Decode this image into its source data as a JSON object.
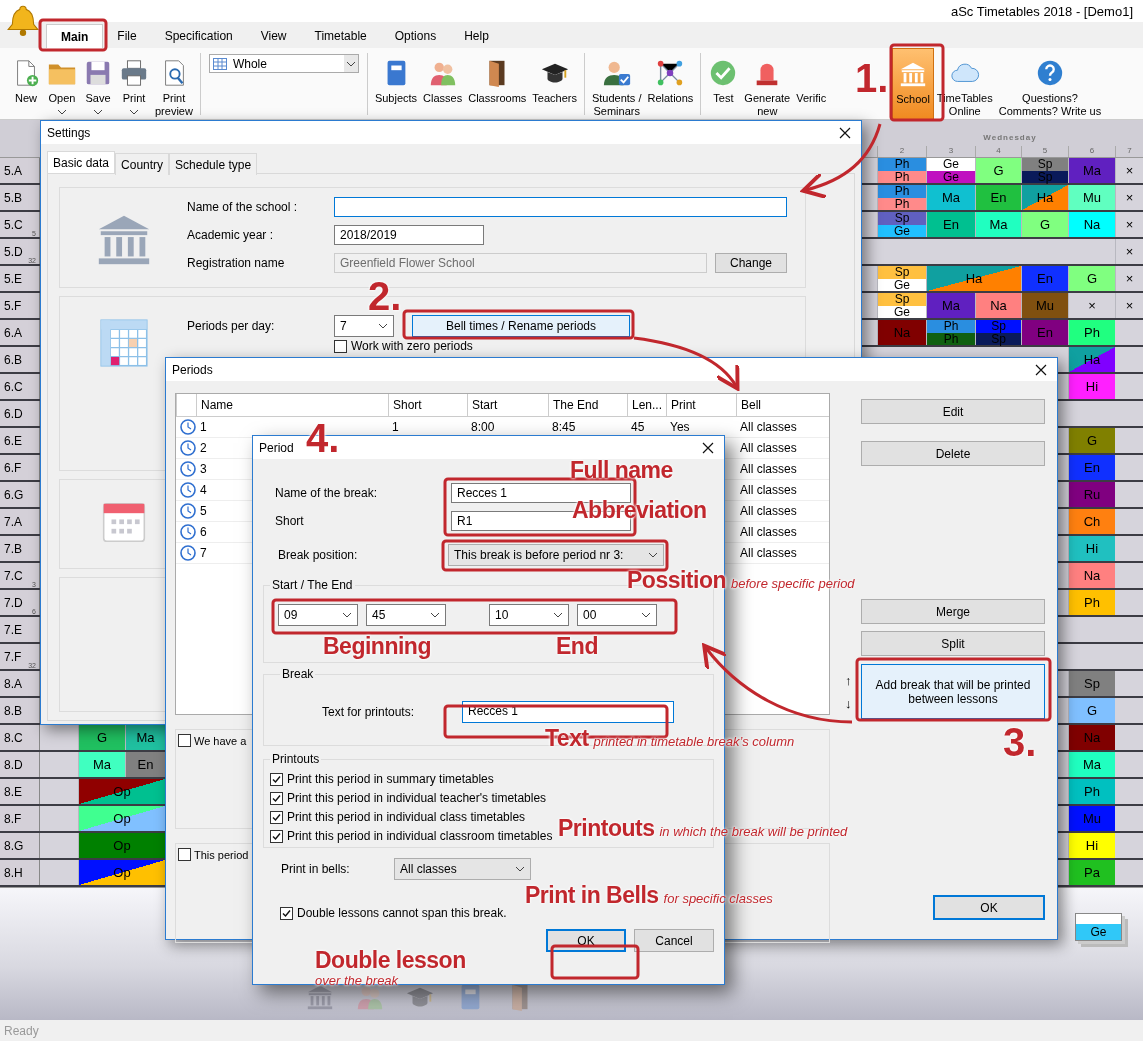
{
  "window": {
    "title": "aSc Timetables 2018  - [Demo1]"
  },
  "menu": [
    {
      "label": "Main",
      "selected": true
    },
    {
      "label": "File",
      "selected": false
    },
    {
      "label": "Specification",
      "selected": false
    },
    {
      "label": "View",
      "selected": false
    },
    {
      "label": "Timetable",
      "selected": false
    },
    {
      "label": "Options",
      "selected": false
    },
    {
      "label": "Help",
      "selected": false
    }
  ],
  "toolbar": {
    "file_buttons": [
      {
        "label": "New",
        "dropdown": false
      },
      {
        "label": "Open",
        "dropdown": true
      },
      {
        "label": "Save",
        "dropdown": true
      },
      {
        "label": "Print",
        "dropdown": true
      },
      {
        "label": "Print\npreview",
        "dropdown": false
      }
    ],
    "view_select": {
      "value": "Whole"
    },
    "groups": [
      [
        {
          "label": "Subjects",
          "selected": false
        },
        {
          "label": "Classes",
          "selected": false
        },
        {
          "label": "Classrooms",
          "selected": false
        },
        {
          "label": "Teachers",
          "selected": false
        }
      ],
      [
        {
          "label": "Students /\nSeminars",
          "selected": false
        },
        {
          "label": "Relations",
          "selected": false
        }
      ],
      [
        {
          "label": "Test",
          "selected": false
        },
        {
          "label": "Generate\nnew",
          "selected": false
        },
        {
          "label": "Verific",
          "selected": false
        },
        {
          "label": "School",
          "selected": true
        },
        {
          "label": "TimeTables\nOnline",
          "selected": false
        },
        {
          "label": "Questions?\nComments? Write us",
          "selected": false
        }
      ]
    ]
  },
  "timetable": {
    "day": "Wednesday",
    "columns": [
      "2",
      "3",
      "4",
      "5",
      "6",
      "7"
    ],
    "rows": [
      {
        "label": "5.A",
        "cells": [
          {
            "kind": "split",
            "top": {
              "text": "Ph",
              "color": "#2a8ee0"
            },
            "bottom": {
              "text": "Ph",
              "color": "#ff8a8a"
            }
          },
          {
            "kind": "split",
            "top": {
              "text": "Ge",
              "color": "#ffffff"
            },
            "bottom": {
              "text": "Ge",
              "color": "#c010c0"
            }
          },
          {
            "kind": "single",
            "text": "G",
            "color": "#80ff80"
          },
          {
            "kind": "split",
            "top": {
              "text": "Sp",
              "color": "#808080"
            },
            "bottom": {
              "text": "Sp",
              "color": "#0a1a5a"
            }
          },
          {
            "kind": "single",
            "text": "Ma",
            "color": "#6020c0"
          },
          {
            "kind": "single",
            "text": "×"
          }
        ]
      },
      {
        "label": "5.B",
        "cells": [
          {
            "kind": "split",
            "top": {
              "text": "Ph",
              "color": "#2a8ee0"
            },
            "bottom": {
              "text": "Ph",
              "color": "#ff8a8a"
            }
          },
          {
            "kind": "single",
            "text": "Ma",
            "color": "#10c0d0"
          },
          {
            "kind": "single",
            "text": "En",
            "color": "#20c040"
          },
          {
            "kind": "diagonal",
            "text": "Ha",
            "color": "#10a0a0",
            "corner": {
              "color": "#ff8000"
            }
          },
          {
            "kind": "single",
            "text": "Mu",
            "color": "#60ffc0"
          },
          {
            "kind": "single",
            "text": "×"
          }
        ]
      },
      {
        "label": "5.C",
        "note": "5",
        "cells": [
          {
            "kind": "split",
            "top": {
              "text": "Sp",
              "color": "#6060c0"
            },
            "bottom": {
              "text": "Ge",
              "color": "#20c0ff"
            }
          },
          {
            "kind": "single",
            "text": "En",
            "color": "#00c090"
          },
          {
            "kind": "single",
            "text": "Ma",
            "color": "#20ffc0"
          },
          {
            "kind": "single",
            "text": "G",
            "color": "#80ff80"
          },
          {
            "kind": "single",
            "text": "Na",
            "color": "#00ffff"
          },
          {
            "kind": "single",
            "text": "×"
          }
        ]
      },
      {
        "label": "5.D",
        "note": "32",
        "cells": [
          "",
          "",
          "",
          "",
          "",
          {
            "kind": "single",
            "text": "×"
          }
        ]
      },
      {
        "label": "5.E",
        "cells": [
          {
            "kind": "split",
            "top": {
              "text": "Sp",
              "color": "#ffc040"
            },
            "bottom": {
              "text": "Ge",
              "color": "#ffffff"
            }
          },
          {
            "kind": "wide-diagonal",
            "text": "Ha",
            "color": "#10a0a0",
            "corner": {
              "color": "#ff8000"
            }
          },
          "",
          {
            "kind": "single",
            "text": "En",
            "color": "#1030ff"
          },
          {
            "kind": "single",
            "text": "G",
            "color": "#80ff80"
          },
          {
            "kind": "single",
            "text": "×"
          }
        ]
      },
      {
        "label": "5.F",
        "cells": [
          {
            "kind": "split",
            "top": {
              "text": "Sp",
              "color": "#ffc040"
            },
            "bottom": {
              "text": "Ge",
              "color": "#ffffff"
            }
          },
          {
            "kind": "single",
            "text": "Ma",
            "color": "#6020c0"
          },
          {
            "kind": "single",
            "text": "Na",
            "color": "#ff8080"
          },
          {
            "kind": "single",
            "text": "Mu",
            "color": "#805010"
          },
          {
            "kind": "single",
            "text": "×"
          },
          {
            "kind": "single",
            "text": "×"
          }
        ]
      },
      {
        "label": "6.A",
        "cells": [
          {
            "kind": "single",
            "text": "Na",
            "color": "#800000"
          },
          {
            "kind": "split",
            "top": {
              "text": "Ph",
              "color": "#2a8ee0"
            },
            "bottom": {
              "text": "Ph",
              "color": "#106010"
            }
          },
          {
            "kind": "split",
            "top": {
              "text": "Sp",
              "color": "#0010ff"
            },
            "bottom": {
              "text": "Sp",
              "color": "#0a1a5a"
            }
          },
          {
            "kind": "single",
            "text": "En",
            "color": "#800080"
          },
          {
            "kind": "single",
            "text": "Ph",
            "color": "#20ff80"
          }
        ]
      },
      {
        "label": "6.B",
        "cells": [
          "",
          "",
          "",
          "",
          {
            "kind": "diagonal",
            "text": "Ha",
            "color": "#10a0a0",
            "corner": {
              "color": "#8000ff"
            }
          }
        ]
      },
      {
        "label": "6.C",
        "cells": [
          "",
          "",
          "",
          "",
          {
            "kind": "single",
            "text": "Hi",
            "color": "#ff20ff"
          }
        ]
      },
      {
        "label": "6.D",
        "cells": []
      },
      {
        "label": "6.E",
        "cells": [
          "",
          "",
          "",
          "",
          {
            "kind": "single",
            "text": "G",
            "color": "#808000"
          }
        ]
      },
      {
        "label": "6.F",
        "cells": [
          "",
          "",
          "",
          "",
          {
            "kind": "single",
            "text": "En",
            "color": "#1030ff"
          }
        ]
      },
      {
        "label": "6.G",
        "cells": [
          "",
          "",
          "",
          "",
          {
            "kind": "single",
            "text": "Ru",
            "color": "#800080"
          }
        ]
      },
      {
        "label": "7.A",
        "cells": [
          "",
          "",
          "",
          "",
          {
            "kind": "single",
            "text": "Ch",
            "color": "#ff8010"
          }
        ]
      },
      {
        "label": "7.B",
        "cells": [
          "",
          "",
          "",
          "",
          {
            "kind": "single",
            "text": "Hi",
            "color": "#20c0c0"
          }
        ]
      },
      {
        "label": "7.C",
        "note": "3",
        "cells": [
          "",
          "",
          "",
          "",
          {
            "kind": "single",
            "text": "Na",
            "color": "#ff8080"
          }
        ]
      },
      {
        "label": "7.D",
        "note": "6",
        "cells": [
          "",
          "",
          "",
          "",
          {
            "kind": "single",
            "text": "Ph",
            "color": "#ffc000"
          }
        ]
      },
      {
        "label": "7.E",
        "cells": []
      },
      {
        "label": "7.F",
        "note": "32",
        "cells": []
      },
      {
        "label": "8.A",
        "cells": [
          "",
          "",
          "",
          "",
          {
            "kind": "single",
            "text": "Sp",
            "color": "#808080"
          }
        ]
      },
      {
        "label": "8.B",
        "cells": [
          "",
          "",
          "",
          "",
          {
            "kind": "single",
            "text": "G",
            "color": "#80c0ff"
          }
        ]
      },
      {
        "label": "8.C",
        "left": [
          {
            "kind": "single",
            "text": "G",
            "color": "#20c060"
          },
          {
            "kind": "single",
            "text": "Ma",
            "color": "#20c0a0"
          }
        ],
        "cells": [
          "",
          "",
          "",
          "",
          {
            "kind": "single",
            "text": "Na",
            "color": "#800000"
          }
        ]
      },
      {
        "label": "8.D",
        "left": [
          {
            "kind": "single",
            "text": "Ma",
            "color": "#40ffc0"
          },
          {
            "kind": "single",
            "text": "En",
            "color": "#808080"
          }
        ],
        "cells": [
          "",
          "",
          "",
          "",
          {
            "kind": "single",
            "text": "Ma",
            "color": "#20ffc0"
          }
        ]
      },
      {
        "label": "8.E",
        "left": [
          {
            "kind": "wide-diagonal",
            "text": "Op",
            "color": "#900000",
            "corner": {
              "color": "#00c090"
            }
          }
        ],
        "cells": [
          "",
          "",
          "",
          "",
          {
            "kind": "single",
            "text": "Ph",
            "color": "#00c0c0"
          }
        ]
      },
      {
        "label": "8.F",
        "left": [
          {
            "kind": "wide-diagonal",
            "text": "Op",
            "color": "#40ff90",
            "corner": {
              "color": "#80c0ff"
            }
          }
        ],
        "cells": [
          "",
          "",
          "",
          "",
          {
            "kind": "single",
            "text": "Mu",
            "color": "#0010ff"
          }
        ]
      },
      {
        "label": "8.G",
        "left": [
          {
            "kind": "wide",
            "text": "Op",
            "color": "#008000"
          }
        ],
        "cells": [
          "",
          "",
          "",
          "",
          {
            "kind": "single",
            "text": "Hi",
            "color": "#ffff00"
          }
        ]
      },
      {
        "label": "8.H",
        "left": [
          {
            "kind": "wide-diagonal",
            "text": "Op",
            "color": "#0010ff",
            "corner": {
              "color": "#ffc000"
            }
          }
        ],
        "cells": [
          "",
          "",
          "",
          "",
          {
            "kind": "single",
            "text": "Pa",
            "color": "#20c020"
          }
        ]
      }
    ],
    "dock_card": {
      "text": "Ge",
      "color": "#30c8f8"
    }
  },
  "settings": {
    "title": "Settings",
    "tabs": [
      {
        "label": "Basic data",
        "selected": true
      },
      {
        "label": "Country",
        "selected": false
      },
      {
        "label": "Schedule type",
        "selected": false
      }
    ],
    "school_name": {
      "label": "Name of the school :",
      "focused": true
    },
    "academic_year": {
      "label": "Academic year :",
      "value": "2018/2019"
    },
    "registration": {
      "label": "Registration name",
      "value": "Greenfield Flower School",
      "disabled": true,
      "button": "Change"
    },
    "periods_per_day": {
      "label": "Periods per day:",
      "value": "7",
      "bell_button": {
        "label": "Bell times / Rename periods",
        "highlighted": true
      },
      "zero_periods": {
        "label": "Work with zero periods",
        "checked": false
      }
    }
  },
  "periods": {
    "title": "Periods",
    "columns": [
      "Name",
      "Short",
      "Start",
      "The End",
      "Len...",
      "Print",
      "Bell"
    ],
    "rows": [
      {
        "name": "1",
        "short": "1",
        "start": "8:00",
        "end": "8:45",
        "length": "45",
        "print": "Yes",
        "bell": "All classes"
      },
      {
        "name": "2",
        "bell": "All classes"
      },
      {
        "name": "3",
        "bell": "All classes"
      },
      {
        "name": "4",
        "bell": "All classes"
      },
      {
        "name": "5",
        "bell": "All classes"
      },
      {
        "name": "6",
        "bell": "All classes"
      },
      {
        "name": "7",
        "bell": "All classes"
      }
    ],
    "buttons": [
      {
        "label": "Edit",
        "highlighted": false
      },
      {
        "label": "Delete",
        "highlighted": false
      },
      {
        "label": "Merge",
        "highlighted": false
      },
      {
        "label": "Split",
        "highlighted": false
      },
      {
        "label": "Add break that will be printed between lessons",
        "highlighted": true
      }
    ],
    "move_arrows": [
      "↑",
      "↓"
    ],
    "options": [
      {
        "label": "We have a",
        "checked": false
      },
      {
        "label": "This period",
        "checked": false
      }
    ],
    "ok": {
      "label": "OK",
      "default": true
    }
  },
  "period": {
    "title": "Period",
    "name": {
      "label": "Name of the break:",
      "value": "Recces 1"
    },
    "short": {
      "label": "Short",
      "value": "R1"
    },
    "position": {
      "label": "Break position:",
      "value": "This break is before period nr 3:"
    },
    "times": {
      "title": "Start / The End",
      "values": [
        "09",
        "45",
        "10",
        "00"
      ]
    },
    "break": {
      "title": "Break",
      "label": "Text for printouts:",
      "value": "Recces 1",
      "focused": true
    },
    "printouts": {
      "title": "Printouts",
      "options": [
        {
          "label": "Print this period in summary timetables",
          "checked": true
        },
        {
          "label": "Print this period in individual teacher's timetables",
          "checked": true
        },
        {
          "label": "Print this period in individual class timetables",
          "checked": true
        },
        {
          "label": "Print this period in individual classroom timetables",
          "checked": true
        }
      ]
    },
    "bells": {
      "label": "Print in bells:",
      "value": "All classes"
    },
    "double": {
      "label": "Double lessons cannot span this break.",
      "checked": true
    },
    "buttons": [
      {
        "label": "OK",
        "default": true
      },
      {
        "label": "Cancel",
        "default": false
      }
    ]
  },
  "annotations": [
    {
      "kind": "step",
      "text": "1."
    },
    {
      "kind": "step",
      "text": "2."
    },
    {
      "kind": "step",
      "text": "3."
    },
    {
      "kind": "step",
      "text": "4."
    },
    {
      "kind": "label",
      "text": "Full name"
    },
    {
      "kind": "label",
      "text": "Abbreviation"
    },
    {
      "kind": "label",
      "text": "Possition",
      "note": "before specific period"
    },
    {
      "kind": "label",
      "text": "Beginning"
    },
    {
      "kind": "label",
      "text": "End"
    },
    {
      "kind": "label",
      "text": "Text",
      "note": "printed in timetable break’s column"
    },
    {
      "kind": "label",
      "text": "Printouts",
      "note": "in which the break will be printed"
    },
    {
      "kind": "label",
      "text": "Print in Bells",
      "note": "for specific classes"
    },
    {
      "kind": "label",
      "text": "Double lesson",
      "note": "over the break"
    }
  ],
  "status_bar": {
    "text": "Ready"
  }
}
